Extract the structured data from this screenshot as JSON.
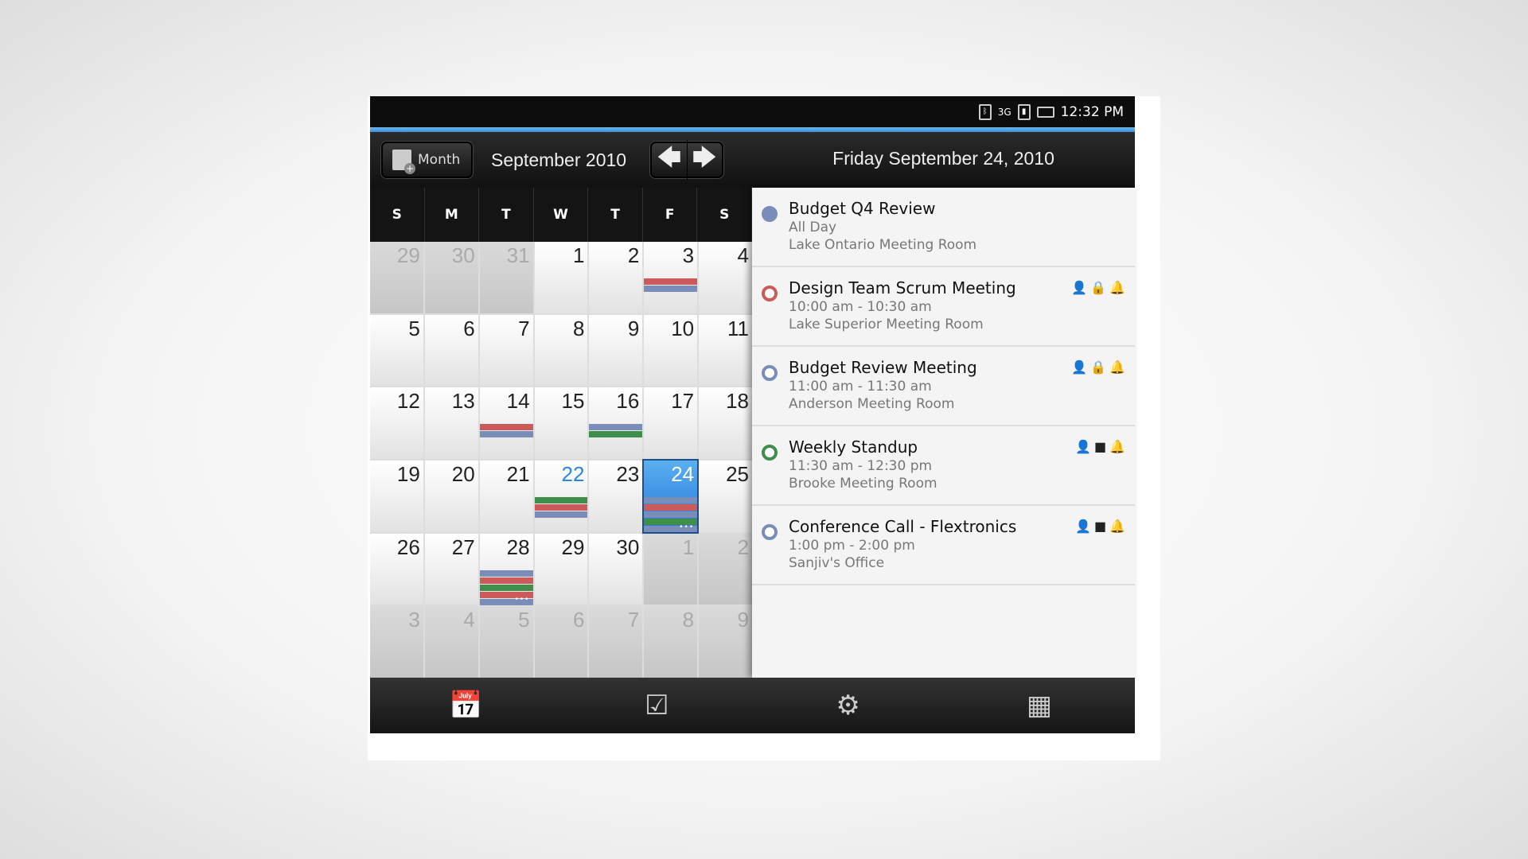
{
  "status": {
    "time": "12:32 PM",
    "icons": [
      "bluetooth-icon",
      "3g-icon",
      "signal-icon",
      "battery-icon"
    ]
  },
  "header": {
    "view_button": "Month",
    "month_title": "September 2010",
    "day_title": "Friday September 24, 2010"
  },
  "weekdays": [
    "S",
    "M",
    "T",
    "W",
    "T",
    "F",
    "S"
  ],
  "colors": {
    "red": "#cc5a5a",
    "blue": "#7a8db8",
    "green": "#3f8f4a",
    "selected": "#2a86e0"
  },
  "days": [
    {
      "n": "29",
      "other": true
    },
    {
      "n": "30",
      "other": true
    },
    {
      "n": "31",
      "other": true
    },
    {
      "n": "1"
    },
    {
      "n": "2"
    },
    {
      "n": "3",
      "bars": [
        "red",
        "blue"
      ]
    },
    {
      "n": "4"
    },
    {
      "n": "5"
    },
    {
      "n": "6"
    },
    {
      "n": "7"
    },
    {
      "n": "8"
    },
    {
      "n": "9"
    },
    {
      "n": "10"
    },
    {
      "n": "11"
    },
    {
      "n": "12"
    },
    {
      "n": "13"
    },
    {
      "n": "14",
      "bars": [
        "red",
        "blue"
      ]
    },
    {
      "n": "15"
    },
    {
      "n": "16",
      "bars": [
        "blue",
        "green"
      ]
    },
    {
      "n": "17"
    },
    {
      "n": "18"
    },
    {
      "n": "19"
    },
    {
      "n": "20"
    },
    {
      "n": "21"
    },
    {
      "n": "22",
      "today": true,
      "bars": [
        "green",
        "red",
        "blue"
      ]
    },
    {
      "n": "23"
    },
    {
      "n": "24",
      "selected": true,
      "bars": [
        "blue",
        "red",
        "blue",
        "green",
        "blue"
      ],
      "more": true
    },
    {
      "n": "25"
    },
    {
      "n": "26"
    },
    {
      "n": "27"
    },
    {
      "n": "28",
      "bars": [
        "blue",
        "red",
        "green",
        "red",
        "blue"
      ],
      "more": true
    },
    {
      "n": "29"
    },
    {
      "n": "30"
    },
    {
      "n": "1",
      "other": true
    },
    {
      "n": "2",
      "other": true
    },
    {
      "n": "3",
      "other": true
    },
    {
      "n": "4",
      "other": true
    },
    {
      "n": "5",
      "other": true
    },
    {
      "n": "6",
      "other": true
    },
    {
      "n": "7",
      "other": true
    },
    {
      "n": "8",
      "other": true
    },
    {
      "n": "9",
      "other": true
    }
  ],
  "events": [
    {
      "title": "Budget Q4 Review",
      "time": "All Day",
      "location": "Lake Ontario Meeting Room",
      "color": "#7a8db8",
      "filled": true,
      "icons": []
    },
    {
      "title": "Design Team Scrum Meeting",
      "time": "10:00 am - 10:30 am",
      "location": "Lake Superior Meeting Room",
      "color": "#cc5a5a",
      "filled": false,
      "icons": [
        "person-icon",
        "lock-icon",
        "bell-icon"
      ]
    },
    {
      "title": "Budget Review Meeting",
      "time": "11:00 am - 11:30 am",
      "location": "Anderson Meeting Room",
      "color": "#7a8db8",
      "filled": false,
      "icons": [
        "person-icon",
        "lock-icon",
        "bell-icon"
      ]
    },
    {
      "title": "Weekly Standup",
      "time": "11:30 am - 12:30 pm",
      "location": "Brooke Meeting Room",
      "color": "#3f8f4a",
      "filled": false,
      "icons": [
        "person-icon",
        "box-icon",
        "bell-icon"
      ]
    },
    {
      "title": "Conference Call - Flextronics",
      "time": "1:00 pm - 2:00 pm",
      "location": "Sanjiv's Office",
      "color": "#7a8db8",
      "filled": false,
      "icons": [
        "person-icon",
        "box-icon",
        "bell-icon"
      ]
    }
  ],
  "toolbar": [
    "add-event-icon",
    "agenda-icon",
    "settings-icon",
    "today-icon"
  ]
}
